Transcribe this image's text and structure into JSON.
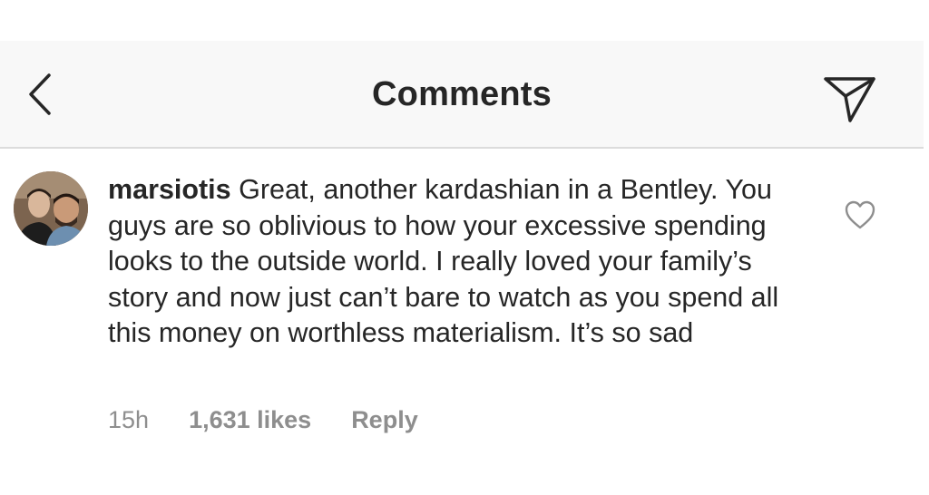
{
  "header": {
    "title": "Comments",
    "back_icon": "chevron-left-icon",
    "share_icon": "paper-plane-icon"
  },
  "comment": {
    "username": "marsiotis",
    "text": " Great, another kardashian in a Bentley. You guys are so oblivious to how your excessive spending looks to the outside world. I really loved your family’s story and now just can’t bare to watch as you spend all this money on worthless materialism. It’s so sad",
    "time": "15h",
    "likes": "1,631 likes",
    "reply_label": "Reply",
    "like_icon": "heart-outline-icon"
  },
  "colors": {
    "header_bg": "#f8f8f8",
    "text": "#262626",
    "muted": "#8e8e8e"
  }
}
